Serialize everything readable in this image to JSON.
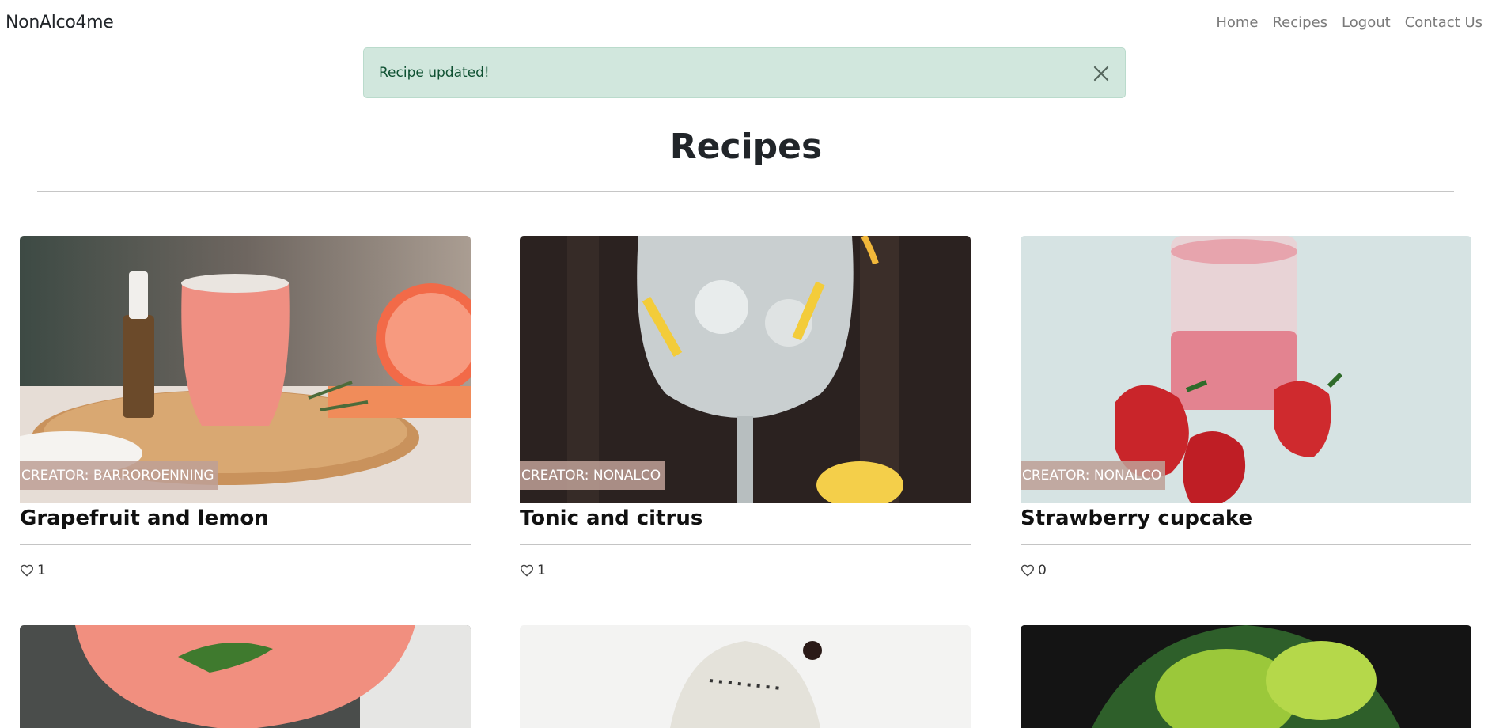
{
  "nav": {
    "brand": "NonAlco4me",
    "links": [
      "Home",
      "Recipes",
      "Logout",
      "Contact Us"
    ]
  },
  "alert": {
    "message": "Recipe updated!"
  },
  "page": {
    "title": "Recipes"
  },
  "recipes": [
    {
      "title": "Grapefruit and lemon",
      "creator": "CREATOR: BARROROENNING",
      "likes": "1"
    },
    {
      "title": "Tonic and citrus",
      "creator": "CREATOR: NONALCO",
      "likes": "1"
    },
    {
      "title": "Strawberry cupcake",
      "creator": "CREATOR: NONALCO",
      "likes": "0"
    }
  ],
  "icons": {
    "close": "close-icon",
    "like": "heart-icon"
  }
}
